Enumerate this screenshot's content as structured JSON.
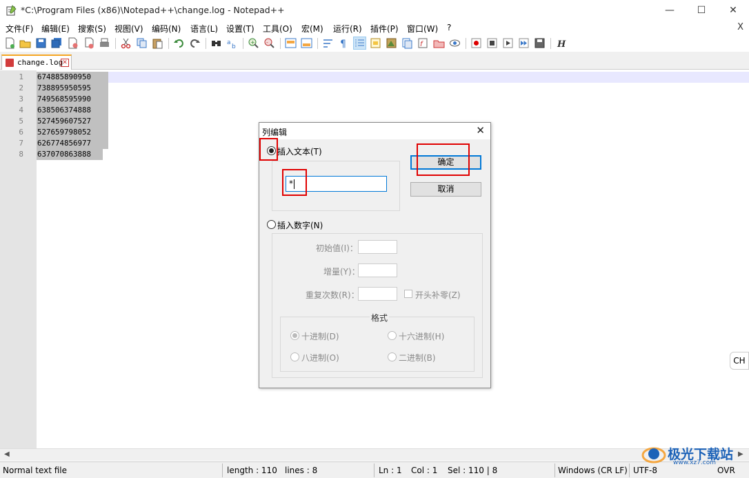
{
  "window": {
    "title": "*C:\\Program Files (x86)\\Notepad++\\change.log - Notepad++",
    "minimize": "—",
    "maximize": "☐",
    "close": "✕"
  },
  "menu": {
    "items": [
      "文件(F)",
      "编辑(E)",
      "搜索(S)",
      "视图(V)",
      "编码(N)",
      "语言(L)",
      "设置(T)",
      "工具(O)",
      "宏(M)",
      "运行(R)",
      "插件(P)",
      "窗口(W)",
      "?"
    ],
    "close": "X"
  },
  "tab": {
    "label": "change.log"
  },
  "editor": {
    "lines": [
      {
        "num": "1",
        "text": "674885890950"
      },
      {
        "num": "2",
        "text": "738895950595"
      },
      {
        "num": "3",
        "text": "749568595990"
      },
      {
        "num": "4",
        "text": "638506374888"
      },
      {
        "num": "5",
        "text": "527459607527"
      },
      {
        "num": "6",
        "text": "527659798052"
      },
      {
        "num": "7",
        "text": "626774856977"
      },
      {
        "num": "8",
        "text": "637070863888"
      }
    ]
  },
  "dialog": {
    "title": "列编辑",
    "insert_text_label": "插入文本(T)",
    "text_value": "*",
    "ok_label": "确定",
    "cancel_label": "取消",
    "insert_number_label": "插入数字(N)",
    "initial_label": "初始值(I)：",
    "increment_label": "增量(Y)：",
    "repeat_label": "重复次数(R)：",
    "leading_zeros_label": "开头补零(Z)",
    "format_label": "格式",
    "dec_label": "十进制(D)",
    "hex_label": "十六进制(H)",
    "oct_label": "八进制(O)",
    "bin_label": "二进制(B)"
  },
  "status": {
    "file_type": "Normal text file",
    "length": "length : 110",
    "lines": "lines : 8",
    "ln": "Ln : 1",
    "col": "Col : 1",
    "sel": "Sel : 110 | 8",
    "eol": "Windows (CR LF)",
    "encoding": "UTF-8",
    "mode": "OVR"
  },
  "ime": {
    "label": "CH"
  },
  "watermark": {
    "text": "极光下载站",
    "url": "www.xz7.com"
  }
}
